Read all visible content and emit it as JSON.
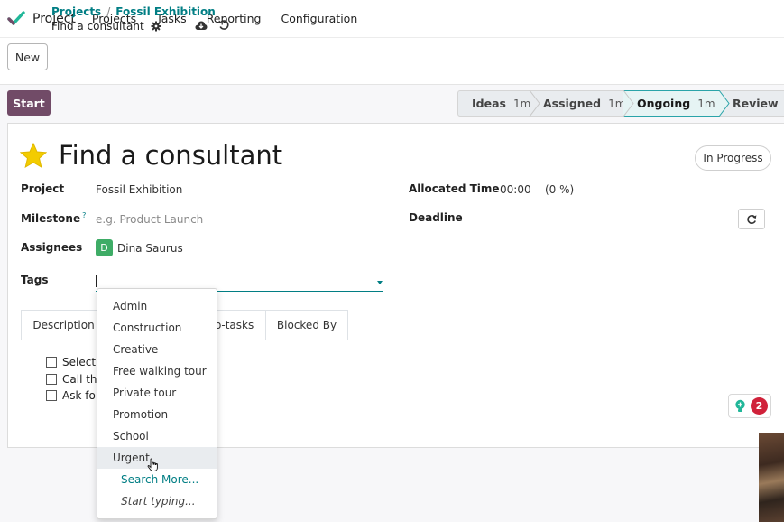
{
  "navbar": {
    "brand": "Project",
    "menu": [
      "Projects",
      "Tasks",
      "Reporting",
      "Configuration"
    ],
    "logo_icon": "checkmark-logo-icon"
  },
  "control": {
    "new_label": "New",
    "breadcrumb_root": "Projects",
    "breadcrumb_separator": "/",
    "breadcrumb_parent": "Fossil Exhibition",
    "breadcrumb_current": "Find a consultant",
    "icons": [
      "gear-icon",
      "cloud-save-icon",
      "discard-icon"
    ]
  },
  "status": {
    "start_label": "Start",
    "stages": [
      {
        "name": "Ideas",
        "duration": "1m"
      },
      {
        "name": "Assigned",
        "duration": "1m"
      },
      {
        "name": "Ongoing",
        "duration": "1m",
        "active": true
      },
      {
        "name": "Review",
        "duration": ""
      }
    ]
  },
  "task": {
    "title": "Find a consultant",
    "priority_icon": "star-icon",
    "state": "In Progress",
    "fields": {
      "project_label": "Project",
      "project_value": "Fossil Exhibition",
      "milestone_label": "Milestone",
      "milestone_help": "?",
      "milestone_placeholder": "e.g. Product Launch",
      "assignees_label": "Assignees",
      "assignee_initial": "D",
      "assignee_name": "Dina Saurus",
      "tags_label": "Tags",
      "allocated_label": "Allocated Time",
      "allocated_value": "00:00",
      "allocated_percent": "(0 %)",
      "deadline_label": "Deadline"
    }
  },
  "tabs": [
    {
      "label": "Description",
      "active": true
    },
    {
      "label": "b-tasks"
    },
    {
      "label": "Blocked By"
    }
  ],
  "checklist": [
    "Select",
    "Call th",
    "Ask fo"
  ],
  "chatter": {
    "count": "2",
    "icon": "lightbulb-icon"
  },
  "dropdown": {
    "items": [
      "Admin",
      "Construction",
      "Creative",
      "Free walking tour",
      "Private tour",
      "Promotion",
      "School",
      "Urgent"
    ],
    "hovered": "Urgent",
    "search_more": "Search More...",
    "start_typing": "Start typing..."
  },
  "colors": {
    "primary": "#714b67",
    "accent": "#017e84",
    "assignee": "#3eac66",
    "badge": "#d0213a",
    "star": "#f3cc00"
  }
}
